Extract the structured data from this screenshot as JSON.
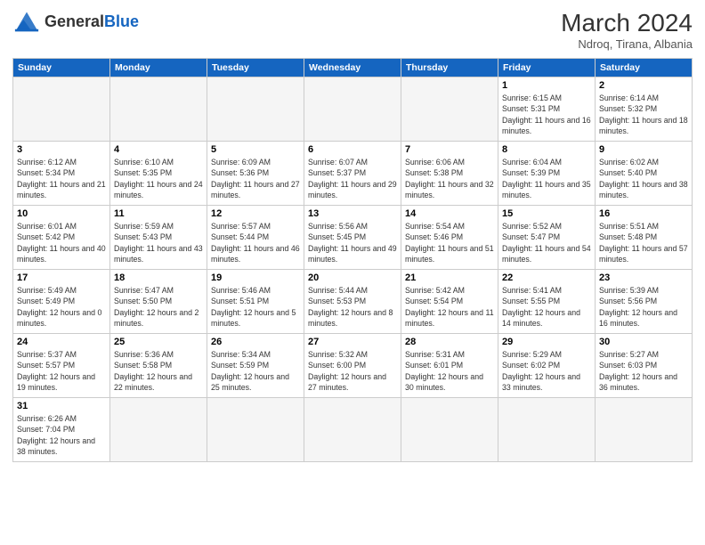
{
  "header": {
    "logo_general": "General",
    "logo_blue": "Blue",
    "title": "March 2024",
    "location": "Ndroq, Tirana, Albania"
  },
  "weekdays": [
    "Sunday",
    "Monday",
    "Tuesday",
    "Wednesday",
    "Thursday",
    "Friday",
    "Saturday"
  ],
  "weeks": [
    [
      {
        "day": "",
        "info": ""
      },
      {
        "day": "",
        "info": ""
      },
      {
        "day": "",
        "info": ""
      },
      {
        "day": "",
        "info": ""
      },
      {
        "day": "",
        "info": ""
      },
      {
        "day": "1",
        "info": "Sunrise: 6:15 AM\nSunset: 5:31 PM\nDaylight: 11 hours and 16 minutes."
      },
      {
        "day": "2",
        "info": "Sunrise: 6:14 AM\nSunset: 5:32 PM\nDaylight: 11 hours and 18 minutes."
      }
    ],
    [
      {
        "day": "3",
        "info": "Sunrise: 6:12 AM\nSunset: 5:34 PM\nDaylight: 11 hours and 21 minutes."
      },
      {
        "day": "4",
        "info": "Sunrise: 6:10 AM\nSunset: 5:35 PM\nDaylight: 11 hours and 24 minutes."
      },
      {
        "day": "5",
        "info": "Sunrise: 6:09 AM\nSunset: 5:36 PM\nDaylight: 11 hours and 27 minutes."
      },
      {
        "day": "6",
        "info": "Sunrise: 6:07 AM\nSunset: 5:37 PM\nDaylight: 11 hours and 29 minutes."
      },
      {
        "day": "7",
        "info": "Sunrise: 6:06 AM\nSunset: 5:38 PM\nDaylight: 11 hours and 32 minutes."
      },
      {
        "day": "8",
        "info": "Sunrise: 6:04 AM\nSunset: 5:39 PM\nDaylight: 11 hours and 35 minutes."
      },
      {
        "day": "9",
        "info": "Sunrise: 6:02 AM\nSunset: 5:40 PM\nDaylight: 11 hours and 38 minutes."
      }
    ],
    [
      {
        "day": "10",
        "info": "Sunrise: 6:01 AM\nSunset: 5:42 PM\nDaylight: 11 hours and 40 minutes."
      },
      {
        "day": "11",
        "info": "Sunrise: 5:59 AM\nSunset: 5:43 PM\nDaylight: 11 hours and 43 minutes."
      },
      {
        "day": "12",
        "info": "Sunrise: 5:57 AM\nSunset: 5:44 PM\nDaylight: 11 hours and 46 minutes."
      },
      {
        "day": "13",
        "info": "Sunrise: 5:56 AM\nSunset: 5:45 PM\nDaylight: 11 hours and 49 minutes."
      },
      {
        "day": "14",
        "info": "Sunrise: 5:54 AM\nSunset: 5:46 PM\nDaylight: 11 hours and 51 minutes."
      },
      {
        "day": "15",
        "info": "Sunrise: 5:52 AM\nSunset: 5:47 PM\nDaylight: 11 hours and 54 minutes."
      },
      {
        "day": "16",
        "info": "Sunrise: 5:51 AM\nSunset: 5:48 PM\nDaylight: 11 hours and 57 minutes."
      }
    ],
    [
      {
        "day": "17",
        "info": "Sunrise: 5:49 AM\nSunset: 5:49 PM\nDaylight: 12 hours and 0 minutes."
      },
      {
        "day": "18",
        "info": "Sunrise: 5:47 AM\nSunset: 5:50 PM\nDaylight: 12 hours and 2 minutes."
      },
      {
        "day": "19",
        "info": "Sunrise: 5:46 AM\nSunset: 5:51 PM\nDaylight: 12 hours and 5 minutes."
      },
      {
        "day": "20",
        "info": "Sunrise: 5:44 AM\nSunset: 5:53 PM\nDaylight: 12 hours and 8 minutes."
      },
      {
        "day": "21",
        "info": "Sunrise: 5:42 AM\nSunset: 5:54 PM\nDaylight: 12 hours and 11 minutes."
      },
      {
        "day": "22",
        "info": "Sunrise: 5:41 AM\nSunset: 5:55 PM\nDaylight: 12 hours and 14 minutes."
      },
      {
        "day": "23",
        "info": "Sunrise: 5:39 AM\nSunset: 5:56 PM\nDaylight: 12 hours and 16 minutes."
      }
    ],
    [
      {
        "day": "24",
        "info": "Sunrise: 5:37 AM\nSunset: 5:57 PM\nDaylight: 12 hours and 19 minutes."
      },
      {
        "day": "25",
        "info": "Sunrise: 5:36 AM\nSunset: 5:58 PM\nDaylight: 12 hours and 22 minutes."
      },
      {
        "day": "26",
        "info": "Sunrise: 5:34 AM\nSunset: 5:59 PM\nDaylight: 12 hours and 25 minutes."
      },
      {
        "day": "27",
        "info": "Sunrise: 5:32 AM\nSunset: 6:00 PM\nDaylight: 12 hours and 27 minutes."
      },
      {
        "day": "28",
        "info": "Sunrise: 5:31 AM\nSunset: 6:01 PM\nDaylight: 12 hours and 30 minutes."
      },
      {
        "day": "29",
        "info": "Sunrise: 5:29 AM\nSunset: 6:02 PM\nDaylight: 12 hours and 33 minutes."
      },
      {
        "day": "30",
        "info": "Sunrise: 5:27 AM\nSunset: 6:03 PM\nDaylight: 12 hours and 36 minutes."
      }
    ],
    [
      {
        "day": "31",
        "info": "Sunrise: 6:26 AM\nSunset: 7:04 PM\nDaylight: 12 hours and 38 minutes."
      },
      {
        "day": "",
        "info": ""
      },
      {
        "day": "",
        "info": ""
      },
      {
        "day": "",
        "info": ""
      },
      {
        "day": "",
        "info": ""
      },
      {
        "day": "",
        "info": ""
      },
      {
        "day": "",
        "info": ""
      }
    ]
  ]
}
